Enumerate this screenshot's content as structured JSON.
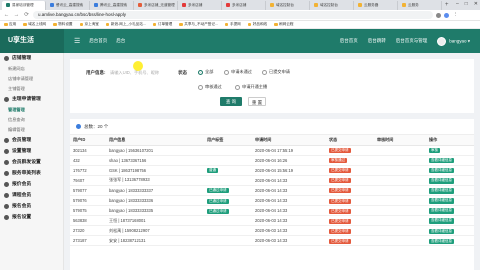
{
  "browser": {
    "tabs": [
      {
        "label": "易家培训管理",
        "color": "#1f7b6a",
        "active": true
      },
      {
        "label": "餐讯云_高建搜索",
        "color": "#3b7ddd",
        "active": false
      },
      {
        "label": "腾讯云_高建搜索",
        "color": "#3b7ddd",
        "active": false
      },
      {
        "label": "多米店铺_无道管理",
        "color": "#e35d3a",
        "active": false
      },
      {
        "label": "多米店铺",
        "color": "#e33a3a",
        "active": false
      },
      {
        "label": "多米店铺",
        "color": "#e33a3a",
        "active": false
      },
      {
        "label": "域名控制台",
        "color": "#f2b233",
        "active": false
      },
      {
        "label": "域名控制台",
        "color": "#f2b233",
        "active": false
      },
      {
        "label": "云服务器",
        "color": "#f2b233",
        "active": false
      },
      {
        "label": "云服务",
        "color": "#f2b233",
        "active": false
      }
    ],
    "url": "u.amlive.bangyao.cn/bsc/bss/line-hosl-apply",
    "bookmarks": [
      "应用",
      "域名上线网",
      "物料设置",
      "京上淘宝",
      "新浪-网上_小礼品站...",
      "订单管理",
      "共享与_不动产登记...",
      "手提网",
      "好品和线",
      "刷网云程"
    ]
  },
  "header": {
    "logo": "U享生活",
    "hamburger_icon": "menu-icon",
    "nav_label": "后台首页",
    "nav_label2": "后台",
    "right_links": [
      "后台首页",
      "后台跳转",
      "后台首页与管理"
    ],
    "username": "bangyao"
  },
  "sidebar": {
    "groups": [
      {
        "label": "店铺管理",
        "items": [
          "新建网店",
          "店铺申请管理",
          "主铺管理"
        ]
      },
      {
        "label": "主理申请管理",
        "items": [
          "管理管理",
          "信息查询",
          "编辑管理"
        ]
      },
      {
        "label": "会员管理",
        "items": []
      },
      {
        "label": "设置管理",
        "items": []
      },
      {
        "label": "会员群发设置",
        "items": []
      },
      {
        "label": "服务审美列表",
        "items": []
      },
      {
        "label": "报价会员",
        "items": []
      },
      {
        "label": "课程会员",
        "items": []
      },
      {
        "label": "报名会员",
        "items": []
      },
      {
        "label": "报名设置",
        "items": []
      }
    ]
  },
  "filter": {
    "user_label": "用户信息:",
    "user_placeholder": "请输入UID、手机号、昵称",
    "status_label": "状态",
    "statuses": [
      "全部",
      "申请未通过",
      "已提交申请",
      "审核通过",
      "申请开通主播"
    ],
    "selected_status": "全部",
    "search_button": "查 询",
    "reset_button": "重 置"
  },
  "table": {
    "total_label": "总数：20 个",
    "columns": [
      "用户ID",
      "用户信息",
      "用户标签",
      "申请时间",
      "状态",
      "审核时间",
      "操作"
    ],
    "rows": [
      {
        "uid": "302134",
        "info": "bangyao | 15636107201",
        "tag": "",
        "time": "2020-06-04 17:55:19",
        "status": "已提交申请",
        "status_color": "#e45a3d",
        "action": "审核"
      },
      {
        "uid": "432",
        "info": "shao | 13673367156",
        "tag": "",
        "time": "2020-06-04 16:26",
        "status": "审核通过",
        "status_color": "#e45a3d",
        "action": "查看详细信息"
      },
      {
        "uid": "176772",
        "info": "GSK | 18637198756",
        "tag": "普通",
        "time": "2020-06-04 15:56:19",
        "status": "已提交申请",
        "status_color": "#e45a3d",
        "action": "查看详细信息"
      },
      {
        "uid": "79407",
        "info": "张张军 | 13136778933",
        "tag": "",
        "time": "2020-06-04 14:33",
        "status": "已提交申请",
        "status_color": "#e45a3d",
        "action": "查看详细信息"
      },
      {
        "uid": "579077",
        "info": "bangyao | 18333333337",
        "tag": "已通过申请",
        "time": "2020-06-04 14:33",
        "status": "已提交申请",
        "status_color": "#e45a3d",
        "action": "查看详细信息"
      },
      {
        "uid": "579076",
        "info": "bangyao | 18333333336",
        "tag": "已通过申请",
        "time": "2020-06-04 14:33",
        "status": "已提交申请",
        "status_color": "#e45a3d",
        "action": "查看详细信息"
      },
      {
        "uid": "579075",
        "info": "bangyao | 18333333335",
        "tag": "已通过申请",
        "time": "2020-06-04 14:33",
        "status": "已提交申请",
        "status_color": "#e45a3d",
        "action": "查看详细信息"
      },
      {
        "uid": "563838",
        "info": "王恒 | 18737168001",
        "tag": "",
        "time": "2020-06-03 14:33",
        "status": "已提交申请",
        "status_color": "#e45a3d",
        "action": "查看详细信息"
      },
      {
        "uid": "27320",
        "info": "刘松禹 | 15908212907",
        "tag": "",
        "time": "2020-06-03 14:33",
        "status": "已提交申请",
        "status_color": "#e45a3d",
        "action": "查看详细信息"
      },
      {
        "uid": "273187",
        "info": "安安 | 18238712131",
        "tag": "",
        "time": "2020-06-03 14:33",
        "status": "已提交申请",
        "status_color": "#e45a3d",
        "action": "查看详细信息"
      }
    ]
  },
  "colors": {
    "brand": "#1f7b6a",
    "accent": "#1f9e7c",
    "danger": "#e45a3d"
  }
}
